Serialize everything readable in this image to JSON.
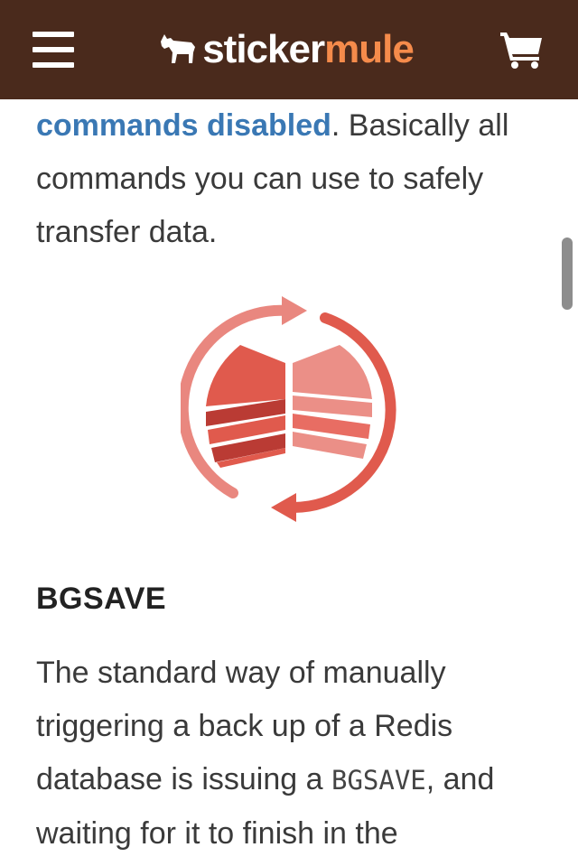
{
  "header": {
    "menu_icon": "hamburger-menu-icon",
    "brand_part1": "sticker",
    "brand_part2": "mule",
    "brand_icon": "mule-icon",
    "cart_icon": "shopping-cart-icon",
    "colors": {
      "background": "#4a2a1c",
      "brand_accent": "#f58b4b"
    }
  },
  "intro": {
    "link_text": "commands disabled",
    "rest_text": ". Basically all commands you can use to safely transfer data."
  },
  "illustration": {
    "icon": "redis-sync-icon"
  },
  "section": {
    "heading": "BGSAVE",
    "para_before": "The standard way of manually triggering a back up of a Redis database is issuing a ",
    "code": "BGSAVE",
    "para_after": ", and waiting for it to finish in the"
  },
  "colors": {
    "link": "#3a78b4",
    "text": "#3a3a3a"
  }
}
